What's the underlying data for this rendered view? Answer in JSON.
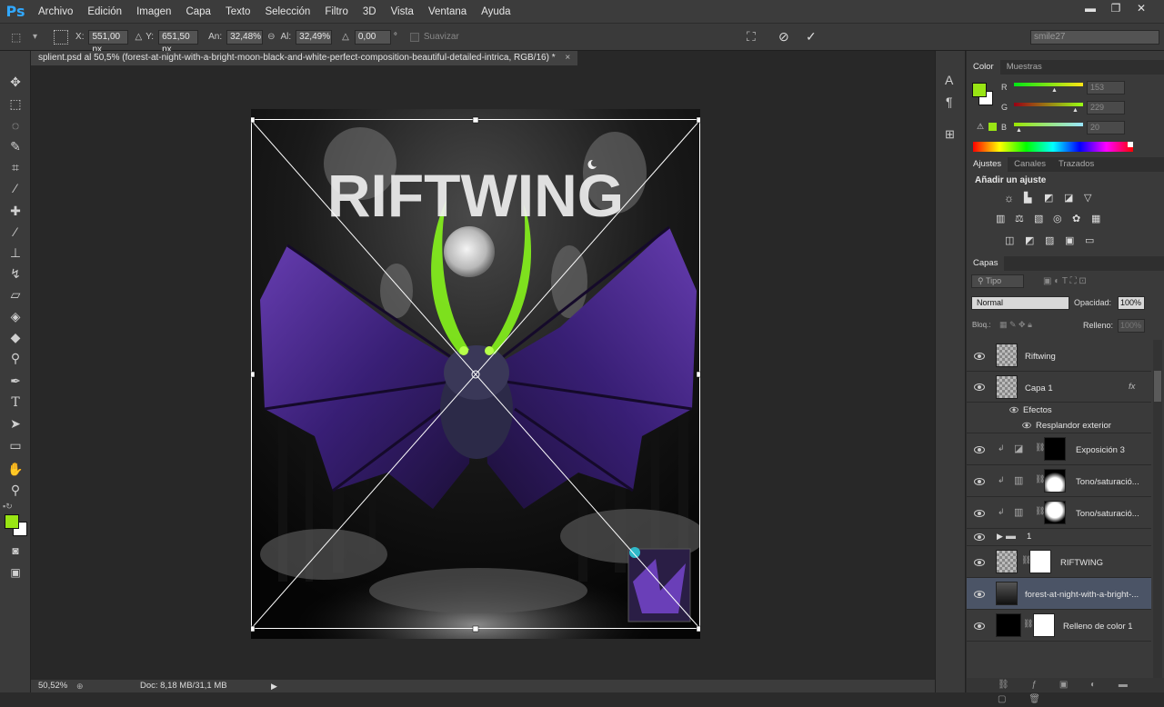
{
  "app": {
    "logo": "Ps"
  },
  "menu": [
    "Archivo",
    "Edición",
    "Imagen",
    "Capa",
    "Texto",
    "Selección",
    "Filtro",
    "3D",
    "Vista",
    "Ventana",
    "Ayuda"
  ],
  "window_controls": {
    "minimize": "▬",
    "restore": "❐",
    "close": "✕"
  },
  "options": {
    "x_label": "X:",
    "x_value": "551,00 px",
    "y_label": "Y:",
    "y_value": "651,50 px",
    "w_label": "An:",
    "w_value": "32,48%",
    "h_label": "Al:",
    "h_value": "32,49%",
    "angle_value": "0,00",
    "angle_unit": "°",
    "smooth_label": "Suavizar",
    "workspace": "smile27"
  },
  "document_tab": {
    "title": "splient.psd al 50,5% (forest-at-night-with-a-bright-moon-black-and-white-perfect-composition-beautiful-detailed-intrica, RGB/16) *",
    "close": "×"
  },
  "artwork": {
    "text": "RIFTWING"
  },
  "status": {
    "zoom": "50,52%",
    "doc": "Doc: 8,18 MB/31,1 MB"
  },
  "color_panel": {
    "tabs": [
      "Color",
      "Muestras"
    ],
    "r_label": "R",
    "r_value": "153",
    "g_label": "G",
    "g_value": "229",
    "b_label": "B",
    "b_value": "20",
    "foreground": "#99e514",
    "background": "#ffffff"
  },
  "adjust_panel": {
    "tabs": [
      "Ajustes",
      "Canales",
      "Trazados"
    ],
    "heading": "Añadir un ajuste"
  },
  "layers_panel": {
    "tab": "Capas",
    "filter_label": "Tipo",
    "blend_mode": "Normal",
    "opacity_label": "Opacidad:",
    "opacity_value": "100%",
    "lock_label": "Bloq.:",
    "fill_label": "Relleno:",
    "fill_value": "100%",
    "layers": [
      {
        "name": "Riftwing"
      },
      {
        "name": "Capa 1",
        "fx": "fx"
      },
      {
        "name": "Efectos"
      },
      {
        "name": "Resplandor exterior"
      },
      {
        "name": "Exposición 3"
      },
      {
        "name": "Tono/saturació..."
      },
      {
        "name": "Tono/saturació..."
      },
      {
        "name": "1"
      },
      {
        "name": "RIFTWING"
      },
      {
        "name": "forest-at-night-with-a-bright-..."
      },
      {
        "name": "Relleno de color 1"
      }
    ]
  }
}
